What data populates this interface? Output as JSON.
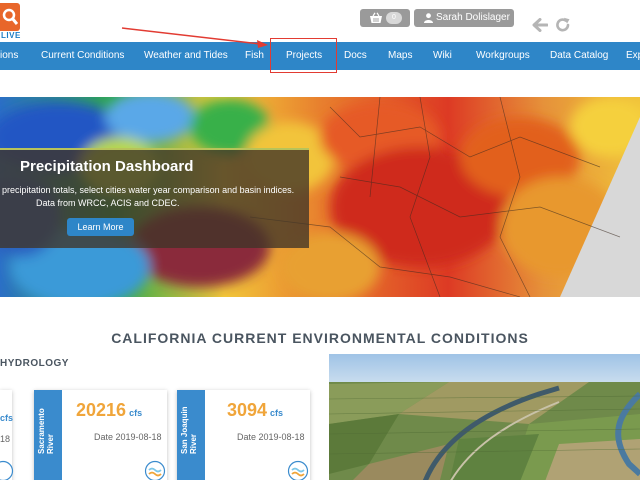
{
  "header": {
    "logo_text": "LIVE",
    "cart_count": "0",
    "user_name": "Sarah Dolislager"
  },
  "nav": {
    "items": [
      {
        "label": "ions"
      },
      {
        "label": "Current Conditions"
      },
      {
        "label": "Weather and Tides"
      },
      {
        "label": "Fish"
      },
      {
        "label": "Projects"
      },
      {
        "label": "Docs"
      },
      {
        "label": "Maps"
      },
      {
        "label": "Wiki"
      },
      {
        "label": "Workgroups"
      },
      {
        "label": "Data Catalog"
      },
      {
        "label": "Exp"
      }
    ]
  },
  "hero": {
    "title": "Precipitation Dashboard",
    "desc_line1": "precipitation totals, select cities water year comparison and basin indices.",
    "desc_line2": "Data from WRCC, ACIS and CDEC.",
    "button_label": "Learn More"
  },
  "conditions": {
    "title": "CALIFORNIA CURRENT ENVIRONMENTAL CONDITIONS",
    "hydrology_label": "HYDROLOGY",
    "partial_card": {
      "unit": "cfs",
      "date": "18"
    },
    "cards": [
      {
        "river": "Sacramento River",
        "value": "20216",
        "unit": "cfs",
        "date": "Date 2019-08-18"
      },
      {
        "river": "San Joaquin River",
        "value": "3094",
        "unit": "cfs",
        "date": "Date 2019-08-18"
      }
    ]
  },
  "colors": {
    "nav_blue": "#2e86c8",
    "value_orange": "#f0a53a",
    "annotation_red": "#e23b32"
  }
}
